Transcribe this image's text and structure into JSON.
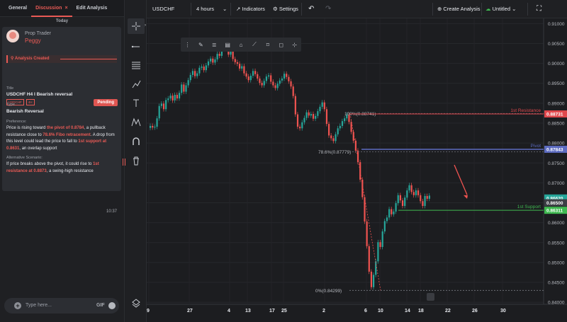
{
  "chat": {
    "tabs": [
      "General",
      "Discussion",
      "Edit Analysis"
    ],
    "active_tab_close": "×",
    "date_divider": "Today",
    "message": {
      "sender_role": "Prop Trader",
      "sender_name": "Peggy",
      "badge": "Analysis Created",
      "tags": [
        "USDCHF",
        "4H"
      ],
      "status": "Pending",
      "title_label": "Title",
      "title": "USDCHF H4 I Bearish reversal",
      "type_label": "Type",
      "type": "Bearish Reversal",
      "preference_label": "Preference:",
      "preference_parts": [
        {
          "t": "Price is rising toward ",
          "h": false
        },
        {
          "t": "the pivot of 0.8784",
          "h": true
        },
        {
          "t": ", a pullback resistance close to ",
          "h": false
        },
        {
          "t": "78.6% Fibo retracement",
          "h": true
        },
        {
          "t": ". A drop from this level could lead the price to fall to ",
          "h": false
        },
        {
          "t": "1st support at 0.8631",
          "h": true
        },
        {
          "t": ", an overlap support",
          "h": false
        }
      ],
      "alt_label": "Alternative Scenario:",
      "alt_parts": [
        {
          "t": "If price breaks above the pivot, it could rise to ",
          "h": false
        },
        {
          "t": "1st resistance at 0.8873",
          "h": true
        },
        {
          "t": ", a swing-high resistance",
          "h": false
        }
      ],
      "time": "10:37"
    },
    "input_placeholder": "Type here...",
    "gif_label": "GIF"
  },
  "toolbar": {
    "symbol": "USDCHF",
    "interval": "4 hours",
    "indicators": "Indicators",
    "settings": "Settings",
    "create_analysis": "Create Analysis",
    "title": "Untitled"
  },
  "colors": {
    "accent": "#e85a55",
    "bull": "#26a69a",
    "bear": "#ef5350",
    "resistance": "#e0484d",
    "pivot": "#5c6bc0",
    "support": "#3fb950"
  },
  "chart_data": {
    "type": "candlestick",
    "symbol": "USDCHF",
    "y_range": [
      0.8395,
      0.9113
    ],
    "price_ticks": [
      "0.91000",
      "0.90500",
      "0.90000",
      "0.89500",
      "0.89000",
      "0.88500",
      "0.88000",
      "0.87500",
      "0.87000",
      "0.86500",
      "0.86000",
      "0.85500",
      "0.85000",
      "0.84500",
      "0.84000"
    ],
    "date_ticks": [
      "9",
      "27",
      "4",
      "13",
      "17",
      "25",
      "2",
      "6",
      "10",
      "14",
      "18",
      "22",
      "26",
      "30"
    ],
    "levels": [
      {
        "name": "1st Resistance",
        "price": 0.87311,
        "label": "0.88731",
        "color": "#e0484d"
      },
      {
        "name": "Pivot",
        "price": 0.87843,
        "label": "0.87843",
        "color": "#5c6bc0"
      },
      {
        "name": "1st Support",
        "price": 0.86311,
        "label": "0.86311",
        "color": "#3fb950"
      }
    ],
    "price_labels": [
      {
        "label": "0.86620",
        "price": 0.8662,
        "color": "#26a69a"
      },
      {
        "label": "0.86500",
        "price": 0.865,
        "color": "#3d3f45"
      }
    ],
    "fib_labels": [
      {
        "text": "100%(0.88741)",
        "price": 0.88741
      },
      {
        "text": "78.6%(0.87779)",
        "price": 0.87779
      },
      {
        "text": "0%(0.84299)",
        "price": 0.84299
      }
    ],
    "closes": [
      0.8843,
      0.8839,
      0.8841,
      0.8862,
      0.8893,
      0.8899,
      0.8885,
      0.8908,
      0.8912,
      0.8919,
      0.8907,
      0.8921,
      0.8912,
      0.8926,
      0.8947,
      0.8929,
      0.8945,
      0.8958,
      0.8971,
      0.8981,
      0.8968,
      0.8975,
      0.8989,
      0.8992,
      0.8983,
      0.8995,
      0.9005,
      0.9012,
      0.9002,
      0.901,
      0.9024,
      0.9019,
      0.9045,
      0.9038,
      0.9041,
      0.9022,
      0.903,
      0.9011,
      0.9003,
      0.8999,
      0.8987,
      0.8993,
      0.8975,
      0.8967,
      0.8958,
      0.8969,
      0.8981,
      0.8973,
      0.8962,
      0.8951,
      0.8945,
      0.8956,
      0.8967,
      0.897,
      0.8954,
      0.8945,
      0.8938,
      0.8949,
      0.8957,
      0.8962,
      0.8974,
      0.8966,
      0.8955,
      0.8942,
      0.8918,
      0.8872,
      0.8841,
      0.8837,
      0.8852,
      0.8863,
      0.8877,
      0.8869,
      0.8873,
      0.8861,
      0.8868,
      0.888,
      0.8891,
      0.8902,
      0.8885,
      0.8848,
      0.8819,
      0.8812,
      0.8805,
      0.8822,
      0.8837,
      0.8843,
      0.8855,
      0.8862,
      0.8871,
      0.8853,
      0.8828,
      0.8806,
      0.8781,
      0.8752,
      0.8708,
      0.8664,
      0.8603,
      0.8541,
      0.8477,
      0.8438,
      0.8469,
      0.8503,
      0.8551,
      0.8539,
      0.8578,
      0.8604,
      0.8613,
      0.8634,
      0.8621,
      0.8628,
      0.8649,
      0.8669,
      0.8656,
      0.8642,
      0.8663,
      0.8681,
      0.8694,
      0.8677,
      0.8669,
      0.8681,
      0.8669,
      0.8654,
      0.8642,
      0.8667,
      0.866,
      0.8668
    ]
  }
}
